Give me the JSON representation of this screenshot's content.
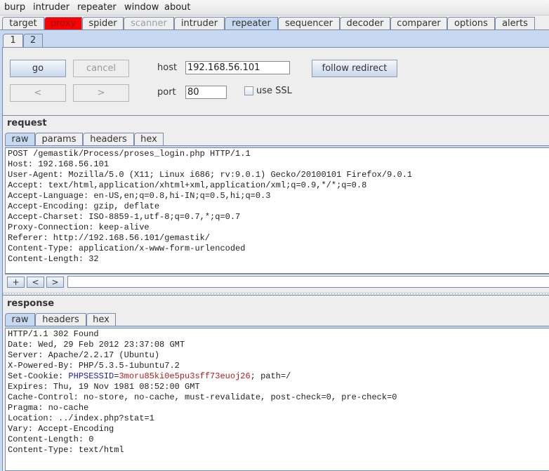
{
  "menubar": {
    "items": [
      "burp",
      "intruder",
      "repeater",
      "window",
      "about"
    ]
  },
  "main_tabs": [
    {
      "label": "target",
      "state": "normal"
    },
    {
      "label": "proxy",
      "state": "alert"
    },
    {
      "label": "spider",
      "state": "normal"
    },
    {
      "label": "scanner",
      "state": "disabled"
    },
    {
      "label": "intruder",
      "state": "normal"
    },
    {
      "label": "repeater",
      "state": "active"
    },
    {
      "label": "sequencer",
      "state": "normal"
    },
    {
      "label": "decoder",
      "state": "normal"
    },
    {
      "label": "comparer",
      "state": "normal"
    },
    {
      "label": "options",
      "state": "normal"
    },
    {
      "label": "alerts",
      "state": "normal"
    }
  ],
  "repeater_tabs": [
    {
      "label": "1",
      "active": false
    },
    {
      "label": "2",
      "active": true
    }
  ],
  "controls": {
    "go_label": "go",
    "cancel_label": "cancel",
    "back_label": "<",
    "forward_label": ">",
    "host_label": "host",
    "host_value": "192.168.56.101",
    "port_label": "port",
    "port_value": "80",
    "ssl_label": "use SSL",
    "ssl_checked": false,
    "follow_redirect_label": "follow redirect"
  },
  "request": {
    "title": "request",
    "tabs": [
      "raw",
      "params",
      "headers",
      "hex"
    ],
    "active_tab": "raw",
    "lines": [
      "POST /gemastik/Process/proses_login.php HTTP/1.1",
      "Host: 192.168.56.101",
      "User-Agent: Mozilla/5.0 (X11; Linux i686; rv:9.0.1) Gecko/20100101 Firefox/9.0.1",
      "Accept: text/html,application/xhtml+xml,application/xml;q=0.9,*/*;q=0.8",
      "Accept-Language: en-US,en;q=0.8,hi-IN;q=0.5,hi;q=0.3",
      "Accept-Encoding: gzip, deflate",
      "Accept-Charset: ISO-8859-1,utf-8;q=0.7,*;q=0.7",
      "Proxy-Connection: keep-alive",
      "Referer: http://192.168.56.101/gemastik/",
      "Content-Type: application/x-www-form-urlencoded",
      "Content-Length: 32"
    ],
    "search": {
      "add_label": "+",
      "prev_label": "<",
      "next_label": ">",
      "value": ""
    }
  },
  "response": {
    "title": "response",
    "tabs": [
      "raw",
      "headers",
      "hex"
    ],
    "active_tab": "raw",
    "lines_before_cookie": [
      "HTTP/1.1 302 Found",
      "Date: Wed, 29 Feb 2012 23:37:08 GMT",
      "Server: Apache/2.2.17 (Ubuntu)",
      "X-Powered-By: PHP/5.3.5-1ubuntu7.2"
    ],
    "cookie": {
      "prefix": "Set-Cookie: ",
      "name": "PHPSESSID",
      "eq": "=",
      "value": "3moru85ki0e5pu3sff73euoj26",
      "suffix": "; path=/"
    },
    "lines_after_cookie": [
      "Expires: Thu, 19 Nov 1981 08:52:00 GMT",
      "Cache-Control: no-store, no-cache, must-revalidate, post-check=0, pre-check=0",
      "Pragma: no-cache",
      "Location: ../index.php?stat=1",
      "Vary: Accept-Encoding",
      "Content-Length: 0",
      "Content-Type: text/html"
    ]
  },
  "colors": {
    "alert_tab": "#ff0000",
    "active_tab": "#c7d9f0",
    "cookie_name": "#1c1cb0",
    "cookie_value": "#b01c1c"
  }
}
